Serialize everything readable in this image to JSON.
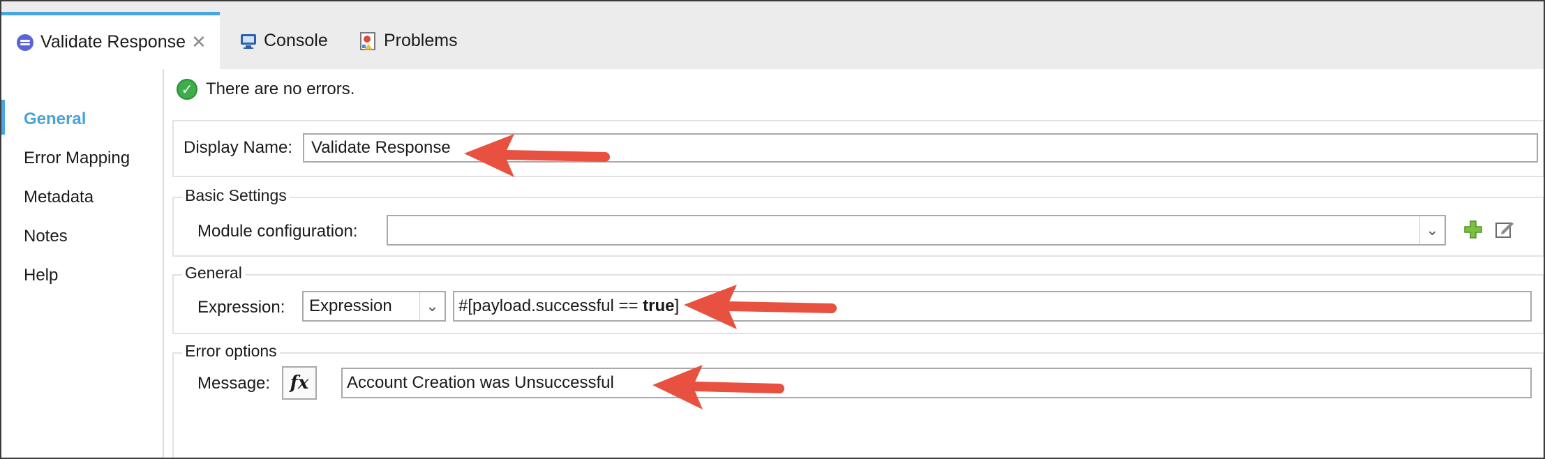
{
  "tabs": [
    {
      "label": "Validate Response",
      "icon": "flow-node-icon",
      "active": true
    },
    {
      "label": "Console",
      "icon": "monitor-icon"
    },
    {
      "label": "Problems",
      "icon": "problems-icon"
    }
  ],
  "sidebar": {
    "items": [
      {
        "label": "General",
        "active": true
      },
      {
        "label": "Error Mapping"
      },
      {
        "label": "Metadata"
      },
      {
        "label": "Notes"
      },
      {
        "label": "Help"
      }
    ]
  },
  "status": {
    "text": "There are no errors."
  },
  "display_name": {
    "label": "Display Name:",
    "value": "Validate Response"
  },
  "basic_settings": {
    "title": "Basic Settings",
    "module_label": "Module configuration:",
    "module_value": ""
  },
  "general": {
    "title": "General",
    "expression_label": "Expression:",
    "expression_mode": "Expression",
    "expression_prefix": "#[payload.successful == ",
    "expression_bold": "true",
    "expression_suffix": "]"
  },
  "error_options": {
    "title": "Error options",
    "message_label": "Message:",
    "fx_label": "fx",
    "message_value": "Account Creation was Unsuccessful"
  },
  "colors": {
    "accent": "#4aa6e0",
    "arrow": "#e8503f",
    "ok": "#3dae4a"
  }
}
